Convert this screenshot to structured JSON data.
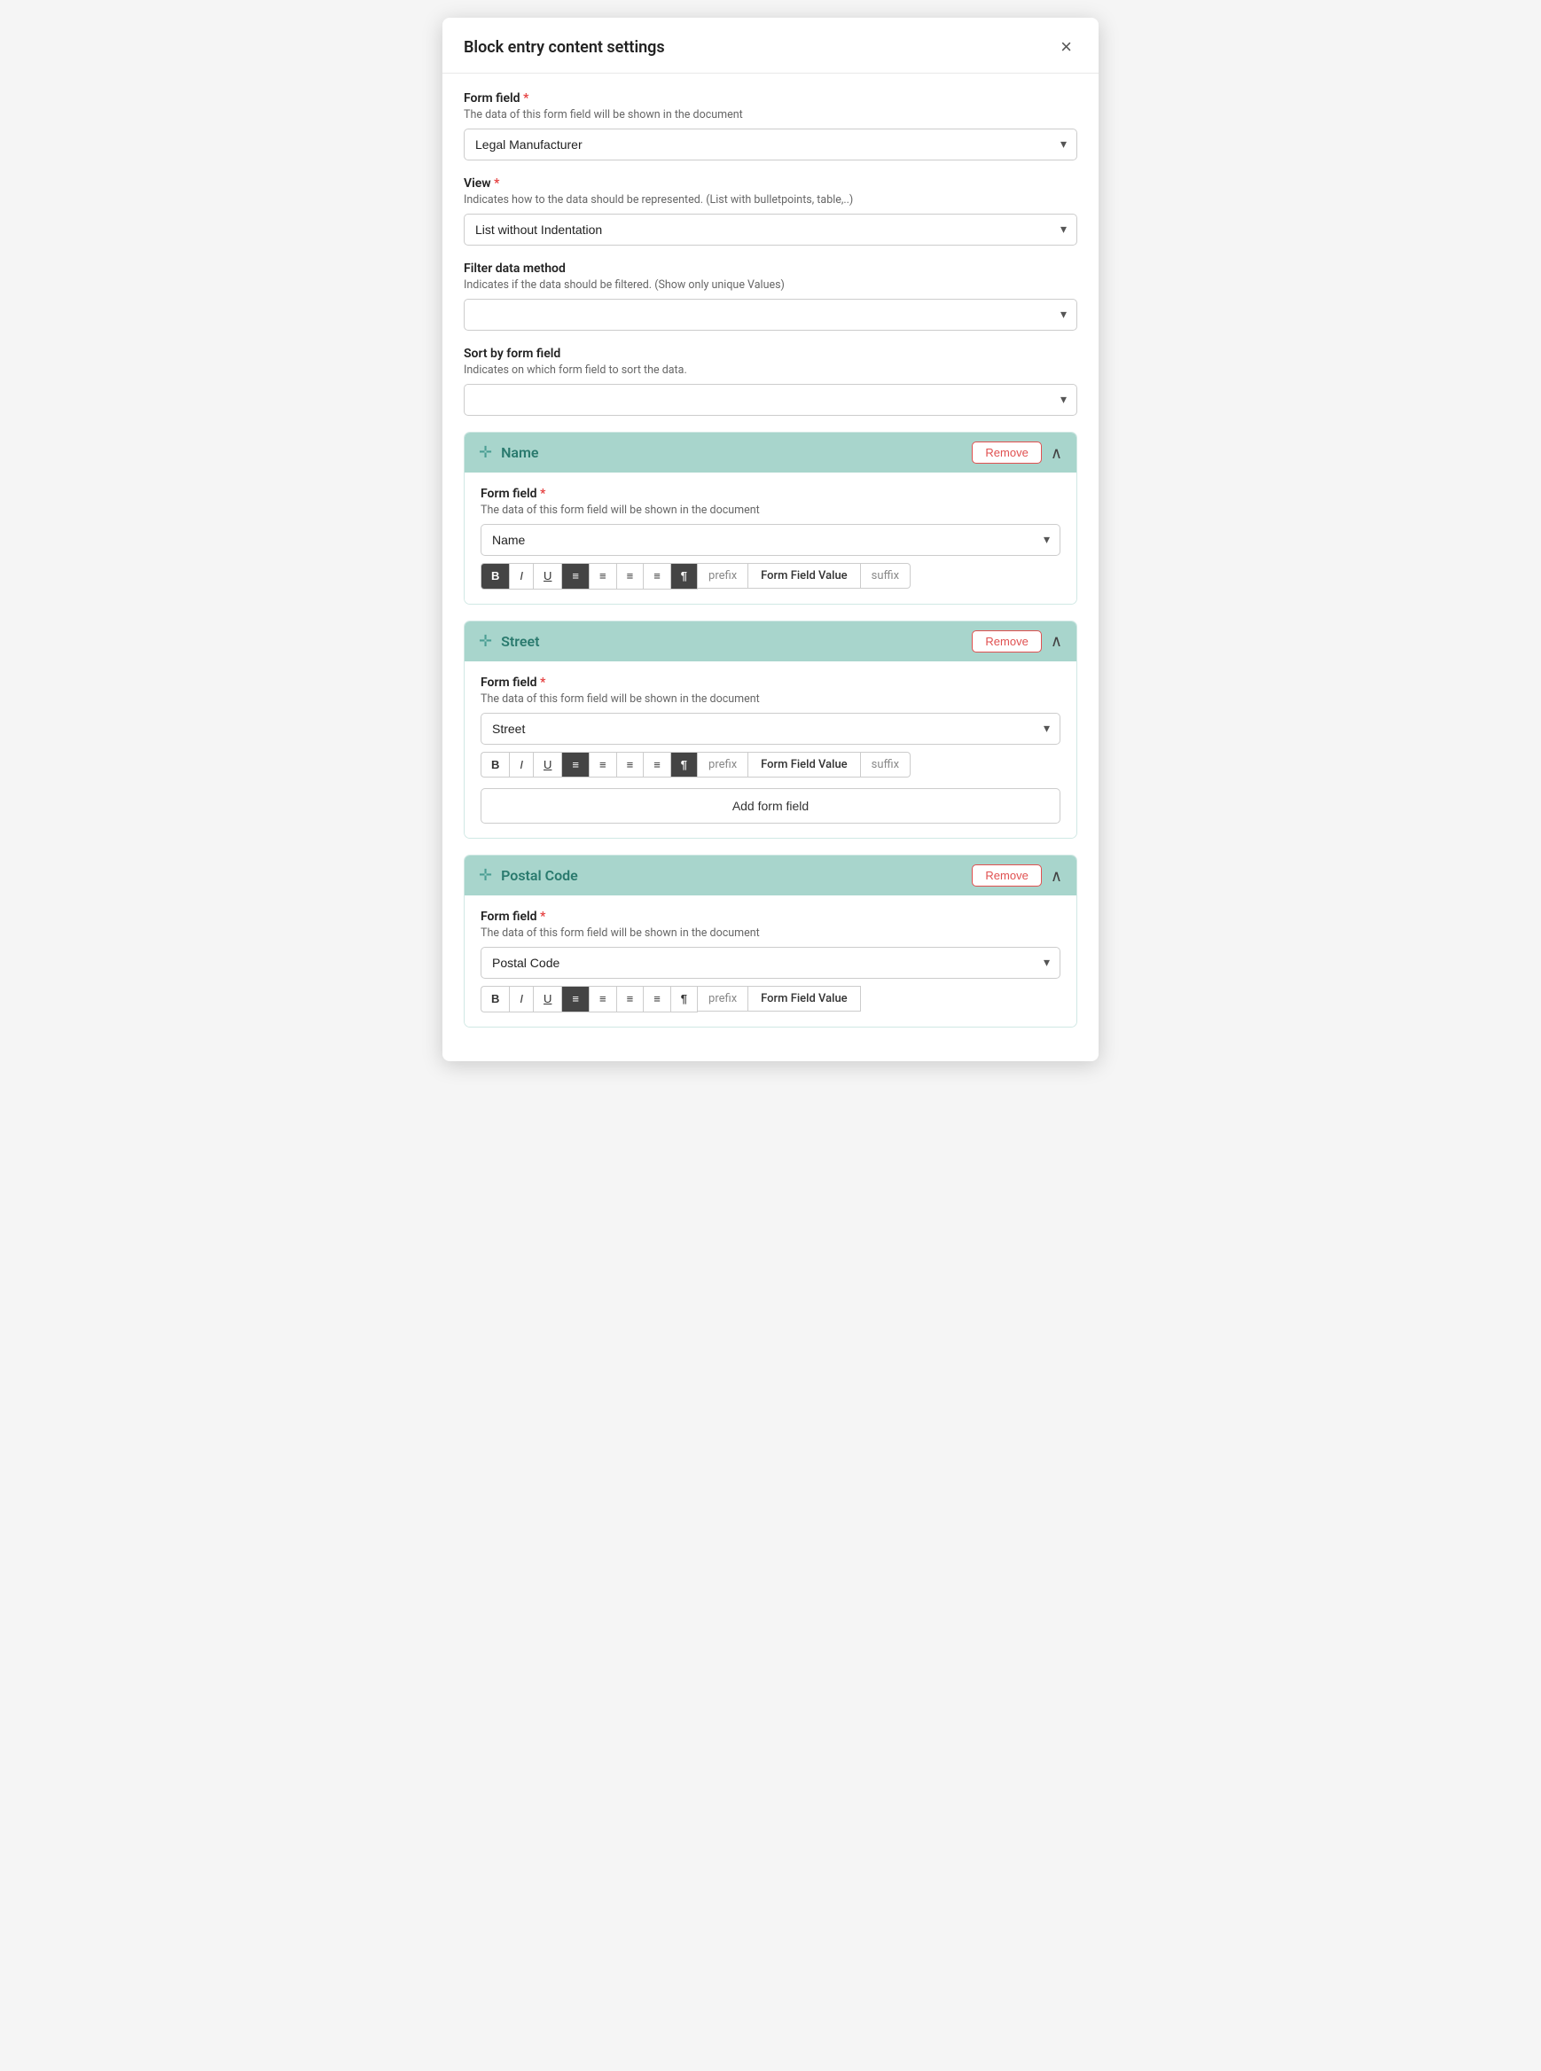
{
  "modal": {
    "title": "Block entry content settings",
    "close_label": "×"
  },
  "form_field_section": {
    "label": "Form field",
    "required": "*",
    "desc": "The data of this form field will be shown in the document",
    "select_value": "Legal Manufacturer",
    "options": [
      "Legal Manufacturer"
    ]
  },
  "view_section": {
    "label": "View",
    "required": "*",
    "desc": "Indicates how to the data should be represented. (List with bulletpoints, table,..)",
    "select_value": "List without Indentation",
    "options": [
      "List without Indentation"
    ]
  },
  "filter_section": {
    "label": "Filter data method",
    "desc": "Indicates if the data should be filtered. (Show only unique Values)",
    "select_value": "",
    "options": []
  },
  "sort_section": {
    "label": "Sort by form field",
    "desc": "Indicates on which form field to sort the data.",
    "select_value": "",
    "options": []
  },
  "blocks": [
    {
      "id": "name-block",
      "title": "Name",
      "remove_label": "Remove",
      "form_field_label": "Form field",
      "required": "*",
      "form_field_desc": "The data of this form field will be shown in the document",
      "select_value": "Name",
      "toolbar_buttons": [
        {
          "id": "bold",
          "label": "B",
          "dark": true
        },
        {
          "id": "italic",
          "label": "I",
          "dark": false
        },
        {
          "id": "underline",
          "label": "U",
          "dark": false
        },
        {
          "id": "align-left",
          "label": "≡",
          "dark": true
        },
        {
          "id": "align-center",
          "label": "≡",
          "dark": false
        },
        {
          "id": "align-justify",
          "label": "≡",
          "dark": false
        },
        {
          "id": "align-right",
          "label": "≡",
          "dark": false
        },
        {
          "id": "paragraph",
          "label": "¶",
          "dark": true
        }
      ],
      "prefix_label": "prefix",
      "field_value_label": "Form Field Value",
      "suffix_label": "suffix"
    },
    {
      "id": "street-block",
      "title": "Street",
      "remove_label": "Remove",
      "form_field_label": "Form field",
      "required": "*",
      "form_field_desc": "The data of this form field will be shown in the document",
      "select_value": "Street",
      "toolbar_buttons": [
        {
          "id": "bold",
          "label": "B",
          "dark": false
        },
        {
          "id": "italic",
          "label": "I",
          "dark": false
        },
        {
          "id": "underline",
          "label": "U",
          "dark": false
        },
        {
          "id": "align-left",
          "label": "≡",
          "dark": true
        },
        {
          "id": "align-center",
          "label": "≡",
          "dark": false
        },
        {
          "id": "align-justify",
          "label": "≡",
          "dark": false
        },
        {
          "id": "align-right",
          "label": "≡",
          "dark": false
        },
        {
          "id": "paragraph",
          "label": "¶",
          "dark": true
        }
      ],
      "prefix_label": "prefix",
      "field_value_label": "Form Field Value",
      "suffix_label": "suffix",
      "add_form_field_label": "Add form field"
    },
    {
      "id": "postal-code-block",
      "title": "Postal Code",
      "remove_label": "Remove",
      "form_field_label": "Form field",
      "required": "*",
      "form_field_desc": "The data of this form field will be shown in the document",
      "select_value": "Postal Code",
      "toolbar_buttons": [
        {
          "id": "bold",
          "label": "B",
          "dark": false
        },
        {
          "id": "italic",
          "label": "I",
          "dark": false
        },
        {
          "id": "underline",
          "label": "U",
          "dark": false
        },
        {
          "id": "align-left",
          "label": "≡",
          "dark": true
        },
        {
          "id": "align-center",
          "label": "≡",
          "dark": false
        },
        {
          "id": "align-justify",
          "label": "≡",
          "dark": false
        },
        {
          "id": "align-right",
          "label": "≡",
          "dark": false
        },
        {
          "id": "paragraph",
          "label": "¶",
          "dark": false
        }
      ],
      "prefix_label": "prefix",
      "field_value_label": "Form Field Value",
      "suffix_label": ""
    }
  ]
}
